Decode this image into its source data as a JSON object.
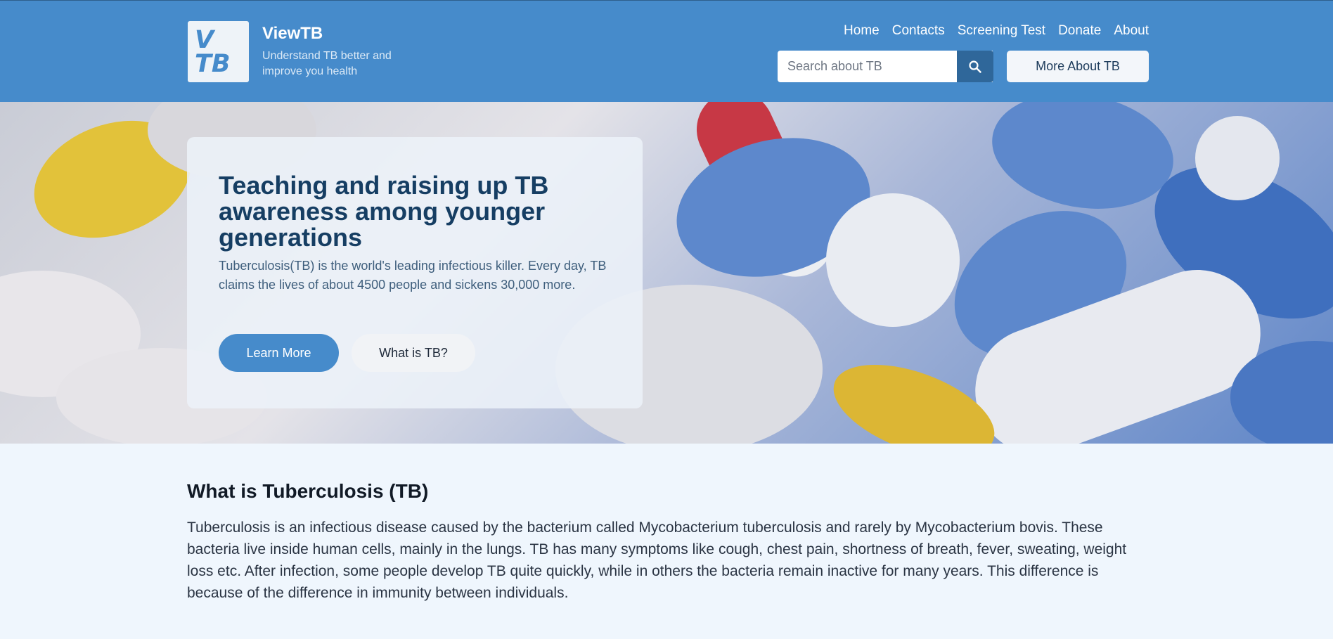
{
  "header": {
    "logo": {
      "line1": "V",
      "line2": "TB"
    },
    "brand_name": "ViewTB",
    "tagline": "Understand TB better and improve you health",
    "nav": [
      "Home",
      "Contacts",
      "Screening Test",
      "Donate",
      "About"
    ],
    "search": {
      "placeholder": "Search about TB",
      "icon": "search-icon"
    },
    "more_button": "More About TB"
  },
  "hero": {
    "title": "Teaching and raising up TB awareness among younger generations",
    "text": "Tuberculosis(TB) is the world's leading infectious killer. Every day, TB claims the lives of about 4500 people and sickens 30,000 more.",
    "learn_more": "Learn More",
    "what_is": "What is TB?"
  },
  "content": {
    "title": "What is Tuberculosis (TB)",
    "paragraph": "Tuberculosis is an infectious disease caused by the bacterium called Mycobacterium tuberculosis and rarely by Mycobacterium bovis. These bacteria live inside human cells, mainly in the lungs. TB has many symptoms like cough, chest pain, shortness of breath, fever, sweating, weight loss etc. After infection, some people develop TB quite quickly, while in others the bacteria remain inactive for many years. This difference is because of the difference in immunity between individuals."
  },
  "colors": {
    "header_bg": "#468bcb",
    "accent_dark": "#2f679a",
    "title_dark": "#163e63",
    "page_bg": "#eff6fd"
  }
}
